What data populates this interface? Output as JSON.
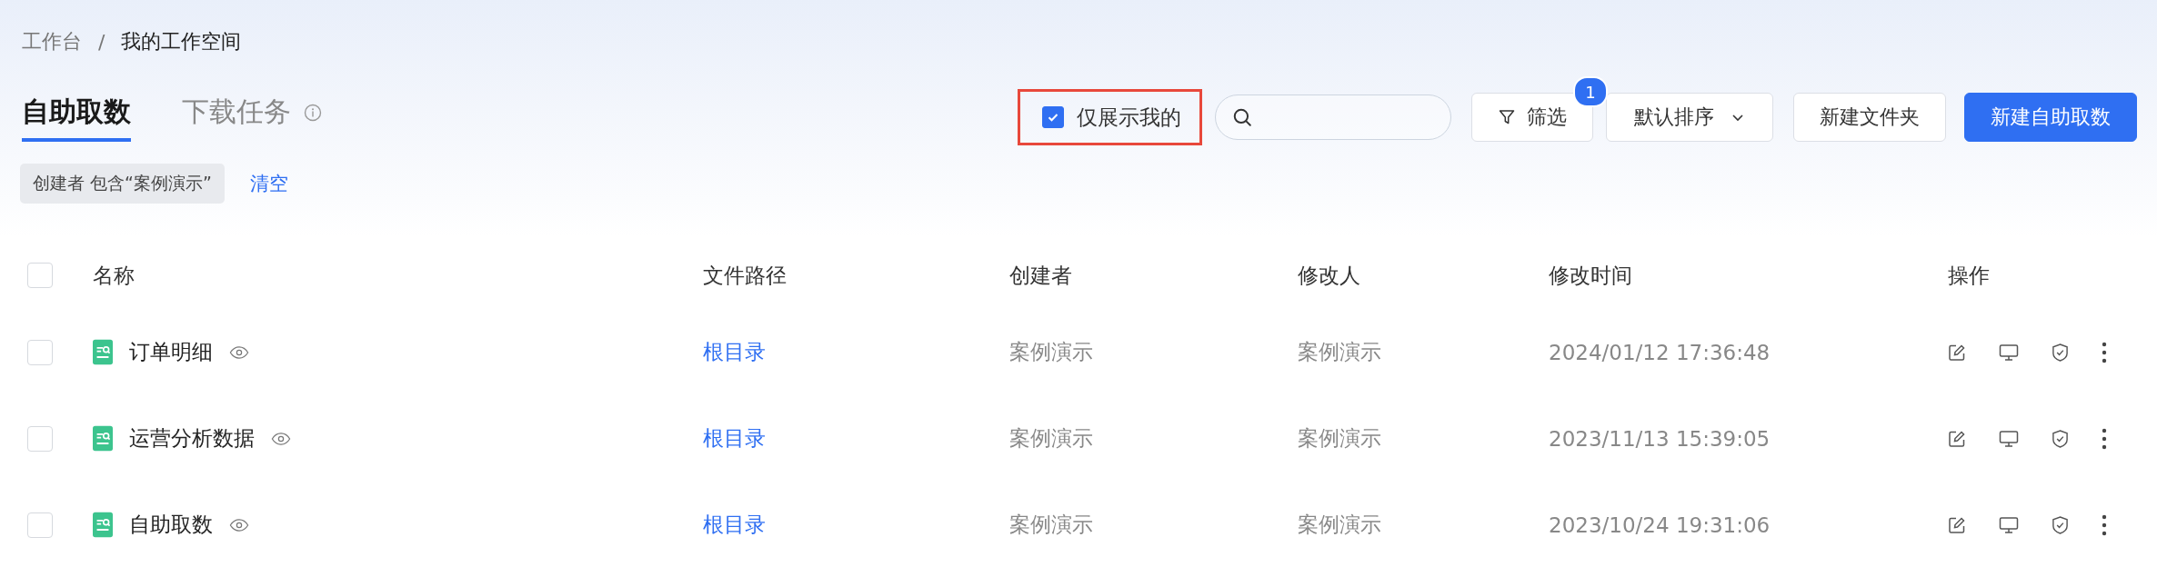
{
  "breadcrumb": [
    "工作台",
    "我的工作空间"
  ],
  "breadcrumb_separator": "/",
  "tabs": [
    {
      "label": "自助取数",
      "selected": true,
      "info": false
    },
    {
      "label": "下载任务",
      "selected": false,
      "info": true
    }
  ],
  "toolbar": {
    "only_mine": {
      "label": "仅展示我的",
      "checked": true,
      "highlighted": true
    },
    "filter_button": {
      "label": "筛选",
      "badge": "1"
    },
    "sort_button": {
      "label": "默认排序"
    },
    "buttons": [
      {
        "label": "新建文件夹",
        "kind": "default"
      },
      {
        "label": "新建自助取数",
        "kind": "primary"
      }
    ]
  },
  "active_filter": {
    "tag": "创建者 包含“案例演示”",
    "clear": "清空"
  },
  "table": {
    "all_selected": false,
    "columns": [
      "名称",
      "文件路径",
      "创建者",
      "修改人",
      "修改时间",
      "操作"
    ],
    "rows": [
      {
        "name": "订单明细",
        "path": "根目录",
        "creator": "案例演示",
        "modifier": "案例演示",
        "modified": "2024/01/12 17:36:48",
        "selected": false
      },
      {
        "name": "运营分析数据",
        "path": "根目录",
        "creator": "案例演示",
        "modifier": "案例演示",
        "modified": "2023/11/13 15:39:05",
        "selected": false
      },
      {
        "name": "自助取数",
        "path": "根目录",
        "creator": "案例演示",
        "modifier": "案例演示",
        "modified": "2023/10/24 19:31:06",
        "selected": false
      }
    ]
  }
}
